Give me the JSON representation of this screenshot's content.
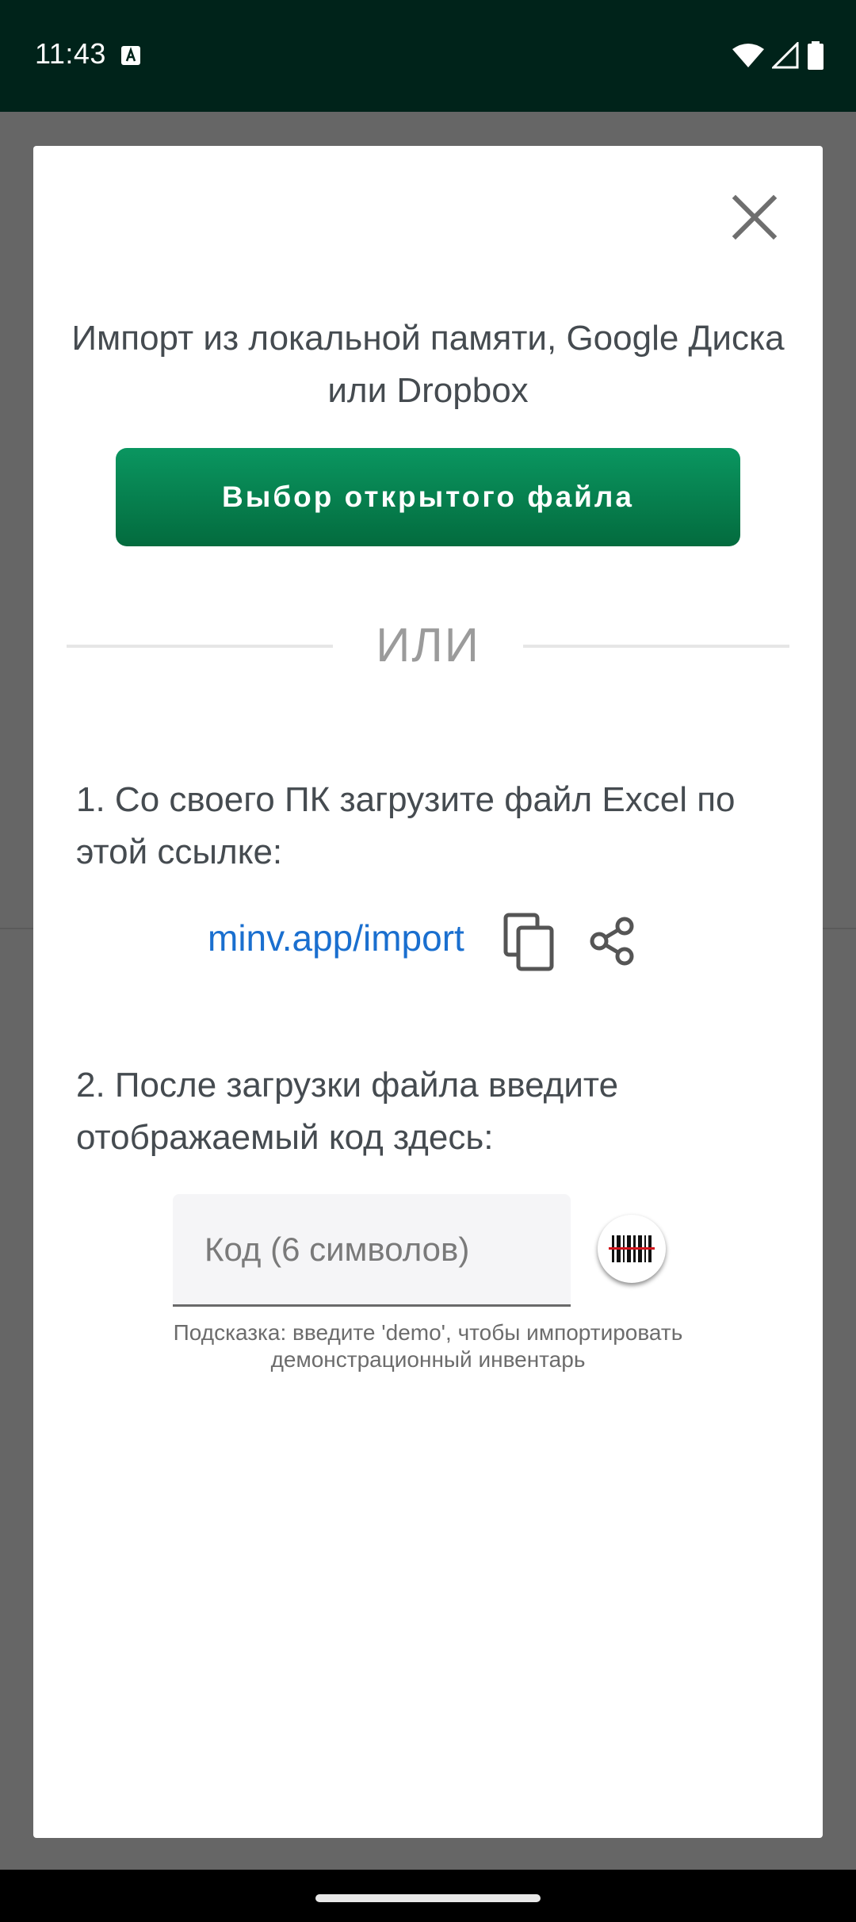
{
  "status_bar": {
    "time": "11:43",
    "notification_icon": "text-a-icon",
    "icons": [
      "wifi-icon",
      "signal-icon",
      "battery-icon"
    ]
  },
  "dialog": {
    "close_icon": "close-icon",
    "title": "Импорт из локальной памяти, Google Диска или Dropbox",
    "pick_file_label": "Выбор открытого файла",
    "or_label": "ИЛИ",
    "step_one": "1. Со своего ПК загрузите файл Excel по этой ссылке:",
    "link_text": "minv.app/import",
    "copy_icon": "copy-icon",
    "share_icon": "share-icon",
    "step_two": "2. После загрузки файла введите отображаемый код здесь:",
    "code_input": {
      "value": "",
      "placeholder": "Код (6 символов)"
    },
    "scan_icon": "barcode-scan-icon",
    "hint": "Подсказка: введите 'demo', чтобы импортировать демонстрационный инвентарь"
  },
  "colors": {
    "primary_button": "#06804f",
    "link": "#1a6fcf",
    "status_bar": "#00231a",
    "scanner_line": "#d0141c"
  }
}
